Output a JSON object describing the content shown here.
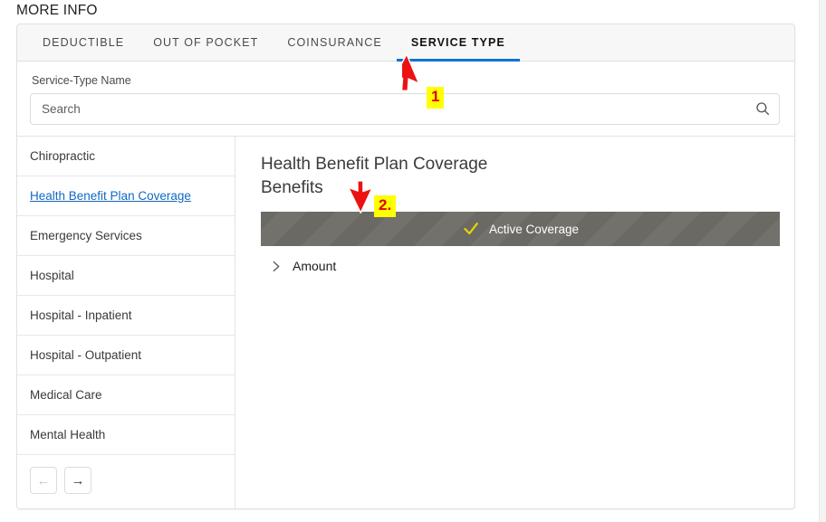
{
  "page": {
    "heading": "MORE INFO"
  },
  "tabs": [
    {
      "label": "DEDUCTIBLE",
      "active": false
    },
    {
      "label": "OUT OF POCKET",
      "active": false
    },
    {
      "label": "COINSURANCE",
      "active": false
    },
    {
      "label": "SERVICE TYPE",
      "active": true
    }
  ],
  "search": {
    "label": "Service-Type Name",
    "placeholder": "Search",
    "value": "",
    "icon": "search-icon"
  },
  "sidebar": {
    "items": [
      {
        "label": "Chiropractic",
        "selected": false
      },
      {
        "label": "Health Benefit Plan Coverage",
        "selected": true
      },
      {
        "label": "Emergency Services",
        "selected": false
      },
      {
        "label": "Hospital",
        "selected": false
      },
      {
        "label": "Hospital - Inpatient",
        "selected": false
      },
      {
        "label": "Hospital - Outpatient",
        "selected": false
      },
      {
        "label": "Medical Care",
        "selected": false
      },
      {
        "label": "Mental Health",
        "selected": false
      }
    ],
    "pagination": {
      "prev_icon": "arrow-left-icon",
      "prev_label": "←",
      "prev_disabled": true,
      "next_icon": "arrow-right-icon",
      "next_label": "→",
      "next_disabled": false
    }
  },
  "detail": {
    "title": "Health Benefit Plan Coverage Benefits",
    "status": {
      "label": "Active Coverage",
      "icon": "check-icon",
      "icon_color": "#e9d600",
      "background_color": "#6d6c67",
      "text_color": "#ffffff"
    },
    "sections": [
      {
        "label": "Amount",
        "expanded": false,
        "icon": "chevron-right-icon"
      }
    ]
  },
  "annotations": {
    "accent_color": "#e00000",
    "badge_background": "#ffff00",
    "markers": [
      {
        "label": "1",
        "target": "tab-service-type"
      },
      {
        "label": "2.",
        "target": "detail-title"
      }
    ]
  },
  "theme": {
    "active_tab_underline": "#1073cf",
    "link_color": "#1268c3",
    "card_border": "#e0e0e0"
  }
}
